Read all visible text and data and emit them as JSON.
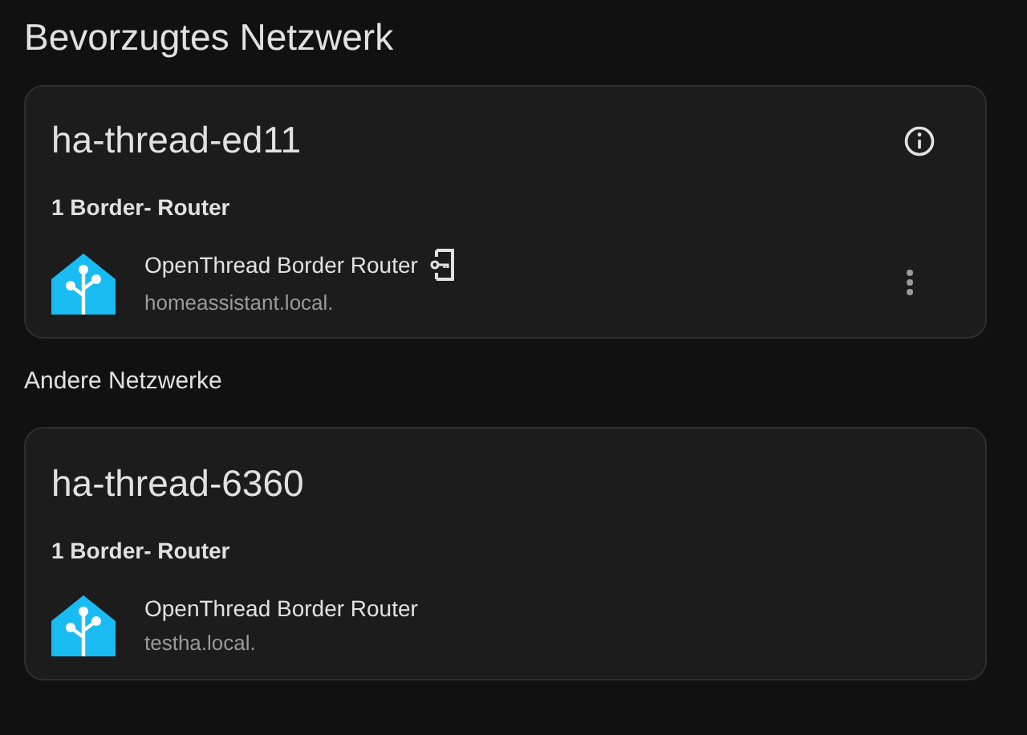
{
  "title": "Bevorzugtes Netzwerk",
  "sections": [
    {
      "networks": [
        {
          "name": "ha-thread-ed11",
          "info_button": true,
          "router_count": "1 Border- Router",
          "routers": [
            {
              "name": "OpenThread Border Router",
              "host": "homeassistant.local.",
              "has_credentials": true,
              "menu": true
            }
          ]
        }
      ]
    },
    {
      "heading": "Andere Netzwerke",
      "networks": [
        {
          "name": "ha-thread-6360",
          "info_button": false,
          "router_count": "1 Border- Router",
          "routers": [
            {
              "name": "OpenThread Border Router",
              "host": "testha.local.",
              "has_credentials": false,
              "menu": false
            }
          ]
        }
      ]
    }
  ]
}
